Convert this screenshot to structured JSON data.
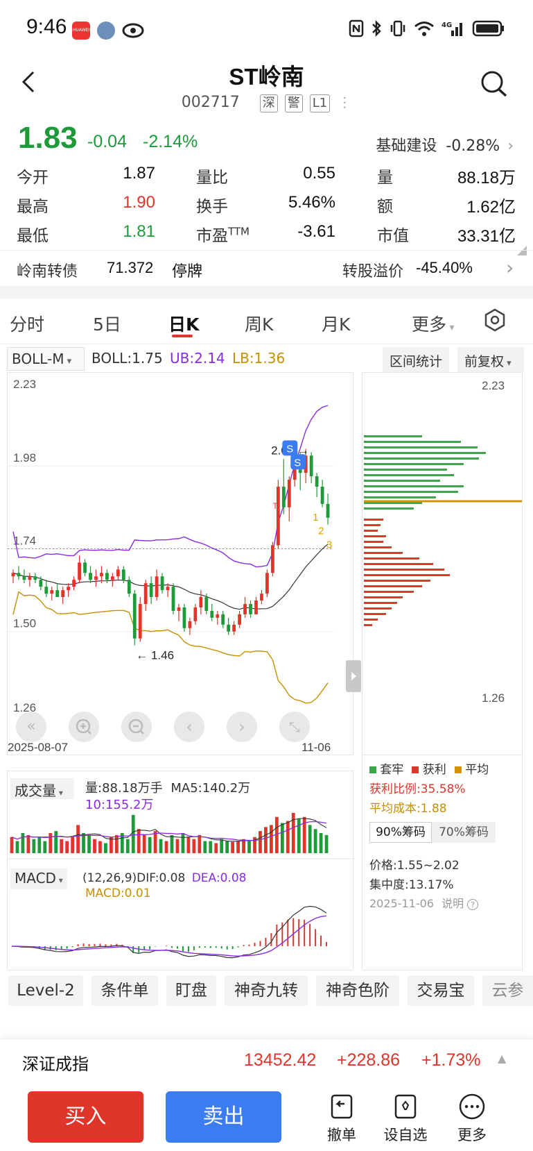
{
  "status": {
    "time": "9:46",
    "huawei_text": "HUAWEI",
    "icons": [
      "huawei-app-icon",
      "avatar-icon",
      "eye-icon",
      "nfc-icon",
      "bluetooth-icon",
      "vibrate-icon",
      "wifi-icon",
      "4g-signal-icon",
      "battery-icon"
    ],
    "network": "4G"
  },
  "header": {
    "title": "ST岭南",
    "code": "002717",
    "tags": [
      "深",
      "警",
      "L1"
    ]
  },
  "quote": {
    "price": "1.83",
    "change": "-0.04",
    "change_pct": "-2.14%",
    "sector_name": "基础建设",
    "sector_pct": "-0.28%",
    "rows": [
      [
        {
          "label": "今开",
          "value": "1.87",
          "color": "#111111"
        },
        {
          "label": "量比",
          "value": "0.55",
          "color": "#111111"
        },
        {
          "label": "量",
          "value": "88.18万",
          "color": "#111111"
        }
      ],
      [
        {
          "label": "最高",
          "value": "1.90",
          "color": "#e0352b"
        },
        {
          "label": "换手",
          "value": "5.46%",
          "color": "#111111"
        },
        {
          "label": "额",
          "value": "1.62亿",
          "color": "#111111"
        }
      ],
      [
        {
          "label": "最低",
          "value": "1.81",
          "color": "#1e9a3a"
        },
        {
          "label": "市盈",
          "sup": "TTM",
          "value": "-3.61",
          "color": "#111111"
        },
        {
          "label": "市值",
          "value": "33.31亿",
          "color": "#111111"
        }
      ]
    ]
  },
  "convertible": {
    "name": "岭南转债",
    "value": "71.372",
    "status": "停牌",
    "premium_label": "转股溢价",
    "premium": "-45.40%"
  },
  "tabs": [
    {
      "label": "分时",
      "active": false
    },
    {
      "label": "5日",
      "active": false
    },
    {
      "label": "日K",
      "active": true
    },
    {
      "label": "周K",
      "active": false
    },
    {
      "label": "月K",
      "active": false
    },
    {
      "label": "更多",
      "active": false
    }
  ],
  "indicator": {
    "select": "BOLL-M",
    "boll_label": "BOLL:1.75",
    "ub_label": "UB:2.14",
    "lb_label": "LB:1.36",
    "range_btn": "区间统计",
    "adjust_btn": "前复权"
  },
  "chart_data": {
    "type": "candlestick",
    "y_ticks": [
      "2.23",
      "1.98",
      "1.74",
      "1.50",
      "1.26"
    ],
    "ylim": [
      1.26,
      2.23
    ],
    "x_start": "2025-08-07",
    "x_end": "11-06",
    "max_label": "2.03",
    "min_label": "1.46",
    "signal_labels": [
      "S",
      "S",
      "T",
      "1",
      "2",
      "3"
    ],
    "candles": [
      [
        1.66,
        1.68,
        1.64,
        1.67
      ],
      [
        1.67,
        1.69,
        1.65,
        1.66
      ],
      [
        1.66,
        1.68,
        1.64,
        1.65
      ],
      [
        1.65,
        1.67,
        1.63,
        1.66
      ],
      [
        1.66,
        1.67,
        1.64,
        1.65
      ],
      [
        1.65,
        1.66,
        1.62,
        1.63
      ],
      [
        1.63,
        1.65,
        1.6,
        1.61
      ],
      [
        1.61,
        1.63,
        1.59,
        1.62
      ],
      [
        1.62,
        1.64,
        1.6,
        1.6
      ],
      [
        1.6,
        1.63,
        1.58,
        1.62
      ],
      [
        1.62,
        1.64,
        1.6,
        1.63
      ],
      [
        1.63,
        1.66,
        1.62,
        1.65
      ],
      [
        1.65,
        1.72,
        1.64,
        1.7
      ],
      [
        1.7,
        1.71,
        1.66,
        1.67
      ],
      [
        1.67,
        1.69,
        1.64,
        1.65
      ],
      [
        1.65,
        1.68,
        1.63,
        1.66
      ],
      [
        1.66,
        1.69,
        1.64,
        1.67
      ],
      [
        1.67,
        1.68,
        1.64,
        1.65
      ],
      [
        1.65,
        1.67,
        1.63,
        1.66
      ],
      [
        1.66,
        1.69,
        1.65,
        1.68
      ],
      [
        1.68,
        1.69,
        1.64,
        1.65
      ],
      [
        1.65,
        1.66,
        1.6,
        1.61
      ],
      [
        1.61,
        1.62,
        1.46,
        1.48
      ],
      [
        1.48,
        1.6,
        1.47,
        1.58
      ],
      [
        1.58,
        1.65,
        1.56,
        1.64
      ],
      [
        1.64,
        1.66,
        1.58,
        1.6
      ],
      [
        1.6,
        1.68,
        1.59,
        1.66
      ],
      [
        1.66,
        1.67,
        1.61,
        1.62
      ],
      [
        1.62,
        1.64,
        1.6,
        1.63
      ],
      [
        1.63,
        1.64,
        1.55,
        1.56
      ],
      [
        1.56,
        1.58,
        1.53,
        1.57
      ],
      [
        1.57,
        1.58,
        1.5,
        1.51
      ],
      [
        1.51,
        1.54,
        1.49,
        1.53
      ],
      [
        1.53,
        1.58,
        1.52,
        1.57
      ],
      [
        1.57,
        1.62,
        1.55,
        1.6
      ],
      [
        1.6,
        1.61,
        1.55,
        1.56
      ],
      [
        1.56,
        1.58,
        1.53,
        1.54
      ],
      [
        1.54,
        1.56,
        1.52,
        1.55
      ],
      [
        1.55,
        1.56,
        1.51,
        1.52
      ],
      [
        1.52,
        1.54,
        1.49,
        1.5
      ],
      [
        1.5,
        1.53,
        1.49,
        1.52
      ],
      [
        1.52,
        1.56,
        1.51,
        1.55
      ],
      [
        1.55,
        1.6,
        1.54,
        1.58
      ],
      [
        1.58,
        1.59,
        1.54,
        1.55
      ],
      [
        1.55,
        1.6,
        1.55,
        1.59
      ],
      [
        1.59,
        1.62,
        1.58,
        1.61
      ],
      [
        1.61,
        1.68,
        1.6,
        1.67
      ],
      [
        1.67,
        1.76,
        1.66,
        1.75
      ],
      [
        1.75,
        1.94,
        1.74,
        1.92
      ],
      [
        1.92,
        2.0,
        1.84,
        1.86
      ],
      [
        1.86,
        1.95,
        1.82,
        1.94
      ],
      [
        1.94,
        2.03,
        1.92,
        1.97
      ],
      [
        1.97,
        2.02,
        1.91,
        1.96
      ],
      [
        1.96,
        2.03,
        1.93,
        2.01
      ],
      [
        2.01,
        2.02,
        1.93,
        1.95
      ],
      [
        1.95,
        1.96,
        1.89,
        1.92
      ],
      [
        1.92,
        1.94,
        1.86,
        1.87
      ],
      [
        1.87,
        1.9,
        1.81,
        1.83
      ]
    ],
    "volume_label": "量:88.18万手",
    "ma5_label": "MA5:140.2万",
    "ma10_label": "10:155.2万",
    "volume_select": "成交量",
    "volumes": [
      0.4,
      0.3,
      0.5,
      0.45,
      0.35,
      0.4,
      0.3,
      0.5,
      0.55,
      0.35,
      0.3,
      0.4,
      0.7,
      0.5,
      0.45,
      0.35,
      0.3,
      0.25,
      0.4,
      0.45,
      0.5,
      0.35,
      0.95,
      0.6,
      0.45,
      0.4,
      0.55,
      0.35,
      0.3,
      0.45,
      0.35,
      0.5,
      0.4,
      0.35,
      0.45,
      0.3,
      0.3,
      0.25,
      0.35,
      0.3,
      0.28,
      0.3,
      0.35,
      0.3,
      0.4,
      0.55,
      0.65,
      0.7,
      0.9,
      0.75,
      0.8,
      1.0,
      0.85,
      0.9,
      0.7,
      0.6,
      0.5,
      0.45
    ],
    "macd_select": "MACD",
    "macd_params": "(12,26,9)",
    "dif_label": "DIF:0.08",
    "dea_label": "DEA:0.08",
    "macd_label": "MACD:0.01",
    "chip_y_top": "2.23",
    "chip_y_bottom": "1.26"
  },
  "chips": {
    "legend": [
      {
        "label": "套牢",
        "color": "#3aa64a"
      },
      {
        "label": "获利",
        "color": "#e0352b"
      },
      {
        "label": "平均",
        "color": "#d49400"
      }
    ],
    "profit_ratio": "获利比例:35.58%",
    "avg_cost": "平均成本:1.88",
    "tab_90": "90%筹码",
    "tab_70": "70%筹码",
    "price_range": "价格:1.55~2.02",
    "concentration": "集中度:13.17%",
    "date": "2025-11-06",
    "explain": "说明"
  },
  "tools": [
    "Level-2",
    "条件单",
    "盯盘",
    "神奇九转",
    "神奇色阶",
    "交易宝",
    "云参"
  ],
  "index": {
    "name": "深证成指",
    "value": "13452.42",
    "change": "+228.86",
    "pct": "+1.73%"
  },
  "bottom": {
    "buy": "买入",
    "sell": "卖出",
    "cancel": "撤单",
    "watch": "设自选",
    "more": "更多"
  },
  "colors": {
    "up": "#e0352b",
    "down": "#1e9a3a",
    "boll_mid": "#333333",
    "boll_up": "#8a2be2",
    "boll_low": "#c49000"
  }
}
